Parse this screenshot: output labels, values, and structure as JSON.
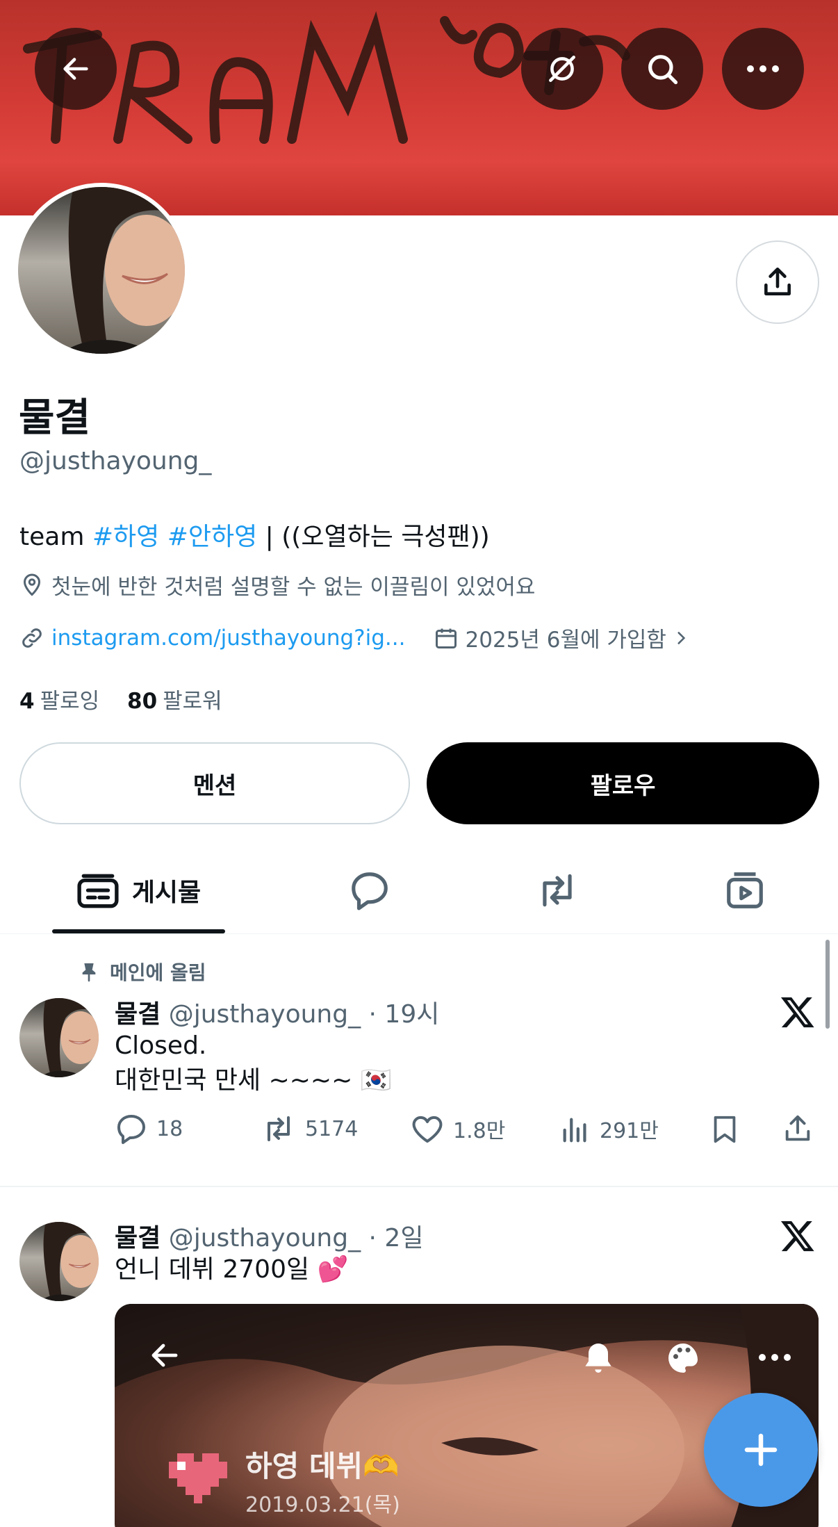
{
  "header": {
    "back_icon": "arrow-left-icon",
    "translate_icon": "no-translate-icon",
    "search_icon": "search-icon",
    "more_icon": "more-horizontal-icon",
    "graffiti_text": "TRAM 하영"
  },
  "profile": {
    "name": "물결",
    "handle": "@justhayoung_",
    "bio_prefix": "team ",
    "bio_tag1": "#하영",
    "bio_tag2": "#안하영",
    "bio_suffix": " | ((오열하는 극성팬))",
    "location": "첫눈에 반한 것처럼 설명할 수 없는 이끌림이 있었어요",
    "link": "instagram.com/justhayoung?ig...",
    "joined": "2025년 6월에 가입함",
    "following_count": "4",
    "following_label": "팔로잉",
    "followers_count": "80",
    "followers_label": "팔로워"
  },
  "buttons": {
    "mention": "멘션",
    "follow": "팔로우"
  },
  "tabs": {
    "posts_label": "게시물"
  },
  "posts": [
    {
      "pinned_label": "메인에 올림",
      "name": "물결",
      "handle": "@justhayoung_",
      "time": " · 19시",
      "line1": "Closed.",
      "line2": "대한민국 만세 ~~~~ 🇰🇷",
      "replies": "18",
      "reposts": "5174",
      "likes": "1.8만",
      "views": "291만"
    },
    {
      "name": "물결",
      "handle": "@justhayoung_",
      "time": " · 2일",
      "line1": "언니 데뷔 2700일 💕",
      "media_title": "하영 데뷔🫶",
      "media_date": "2019.03.21(목)"
    }
  ],
  "colors": {
    "accent": "#1d9bf0",
    "fab": "#4a99e9",
    "text_secondary": "#536471"
  }
}
